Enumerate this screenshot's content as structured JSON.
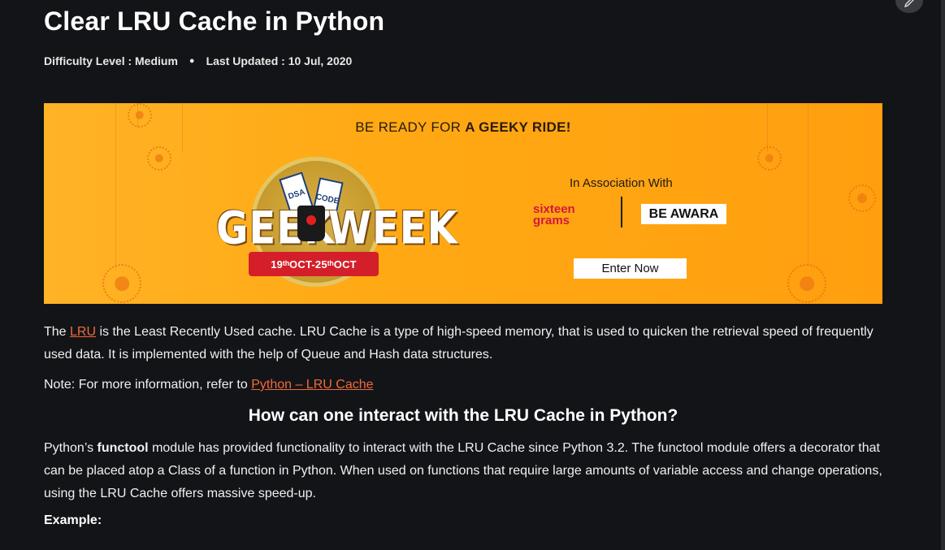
{
  "article": {
    "title": "Clear LRU Cache in Python",
    "difficulty": "Difficulty Level : Medium",
    "separator": "●",
    "updated": "Last Updated : 10 Jul, 2020"
  },
  "banner": {
    "headline_prefix": "BE READY FOR ",
    "headline_bold": "A GEEKY RIDE!",
    "logo_left": "GEEK",
    "logo_right": "WEEK",
    "ticket1": "DSA",
    "ticket2": "CODE",
    "dates": "19ᵗʰOCT-25ᵗʰOCT",
    "association": "In Association With",
    "sponsor1_line1": "sixteen",
    "sponsor1_line2": "grams",
    "sponsor2": "BE AWARA",
    "cta": "Enter Now",
    "background": "#ffab1a"
  },
  "content": {
    "p1_before": "The ",
    "p1_link": "LRU",
    "p1_after": " is the Least Recently Used cache. LRU Cache is a type of high-speed memory, that is used to quicken the retrieval speed of frequently used data. It is implemented with the help of Queue and Hash data structures.",
    "p2_before": "Note: For more information, refer to ",
    "p2_link": "Python – LRU Cache",
    "heading": "How can one interact with the LRU Cache in Python?",
    "p3_before": "Python’s ",
    "p3_bold": "functool",
    "p3_after": " module has provided functionality to interact with the LRU Cache since Python 3.2. The functool module offers a decorator that can be placed atop a Class of a function in Python. When used on functions that require large amounts of variable access and change operations, using the LRU Cache offers massive speed-up.",
    "example_label": "Example:"
  },
  "colors": {
    "background": "#131417",
    "link": "#ef6a3a"
  },
  "icons": {
    "edit": "pencil-icon"
  }
}
